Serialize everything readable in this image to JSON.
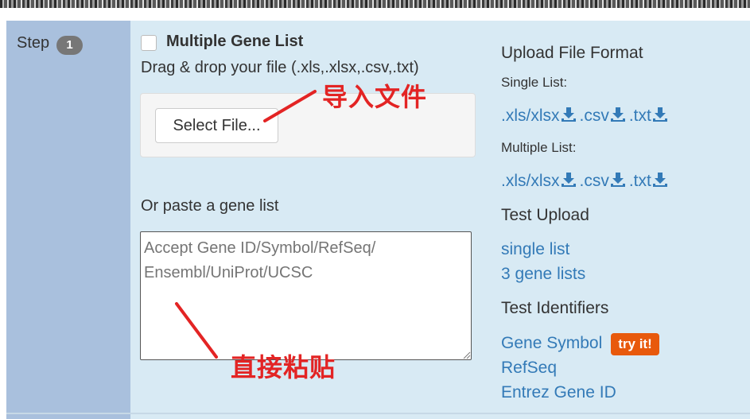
{
  "step": {
    "label": "Step",
    "number": "1"
  },
  "section": {
    "title": "Multiple Gene List",
    "drag_text": "Drag & drop your file (.xls,.xlsx,.csv,.txt)",
    "select_button": "Select File...",
    "paste_label": "Or paste a gene list",
    "textarea_placeholder": "Accept Gene ID/Symbol/RefSeq/\nEnsembl/UniProt/UCSC"
  },
  "sidebar": {
    "upload_format_heading": "Upload File Format",
    "single_list_label": "Single List:",
    "multiple_list_label": "Multiple List:",
    "single_files": [
      ".xls/xlsx",
      ".csv",
      ".txt"
    ],
    "multiple_files": [
      ".xls/xlsx",
      ".csv",
      ".txt"
    ],
    "test_upload_heading": "Test Upload",
    "test_upload_links": [
      "single list",
      "3 gene lists"
    ],
    "test_identifiers_heading": "Test Identifiers",
    "identifier_links": [
      "Gene Symbol",
      "RefSeq",
      "Entrez Gene ID"
    ],
    "try_it_label": "try it!"
  },
  "annotations": {
    "import_file": "导入文件",
    "paste_directly": "直接粘贴"
  },
  "colors": {
    "step_column": "#a9c0dd",
    "panel_background": "#d8eaf4",
    "link": "#337ab7",
    "try_it_badge": "#e8590c",
    "annotation_red": "#e32424"
  }
}
